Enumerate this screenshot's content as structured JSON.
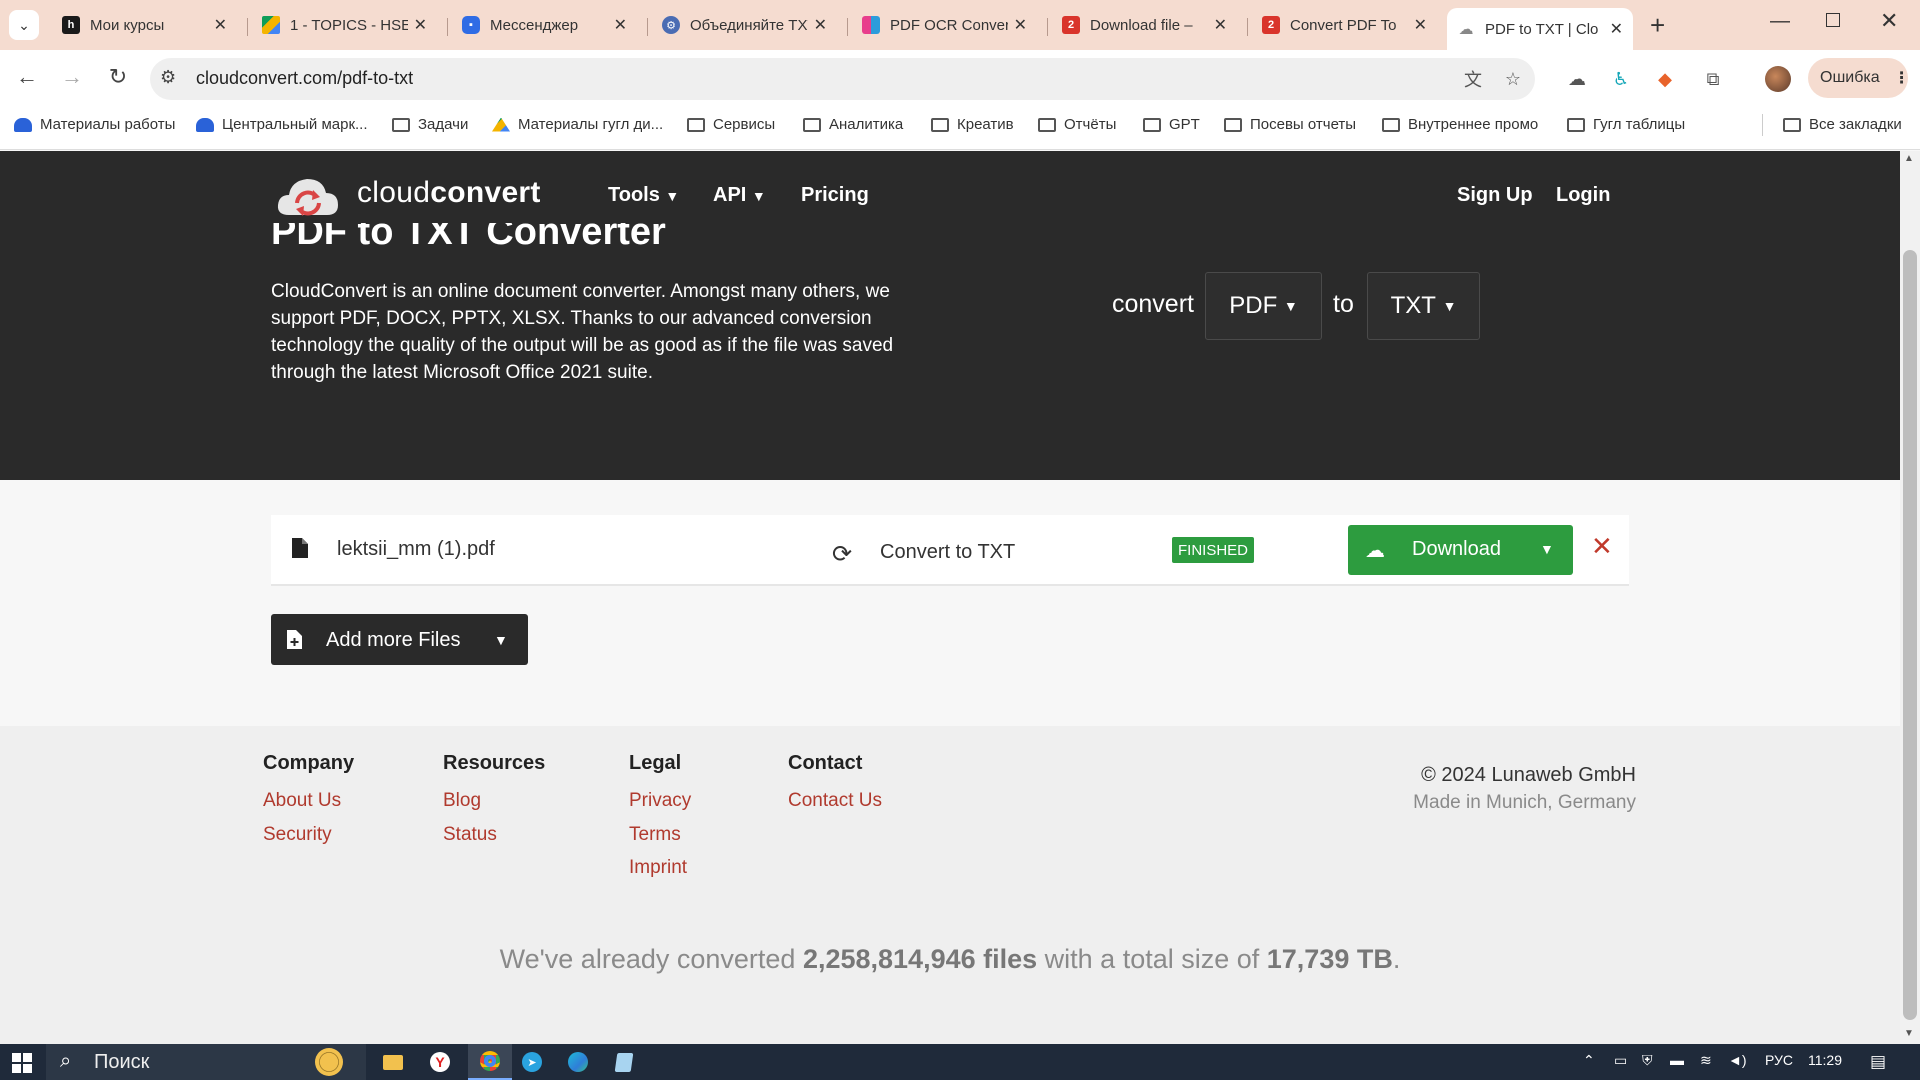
{
  "browser": {
    "tabs": [
      {
        "title": "Мои курсы",
        "favicon": "hse-icon",
        "color": "#1a1a1a"
      },
      {
        "title": "1 - TOPICS - HSE",
        "favicon": "drive-icon",
        "color": "#f4b400"
      },
      {
        "title": "Мессенджер",
        "favicon": "messenger-icon",
        "color": "#2f6ce5"
      },
      {
        "title": "Объединяйте TXT",
        "favicon": "ilove-icon",
        "color": "#4a6cb3"
      },
      {
        "title": "PDF OCR Conver",
        "favicon": "ocr-icon",
        "color": "#e83e8c"
      },
      {
        "title": "Download file –",
        "favicon": "pdf2go-icon",
        "color": "#d9342b"
      },
      {
        "title": "Convert PDF To",
        "favicon": "pdf2go-icon",
        "color": "#d9342b"
      },
      {
        "title": "PDF to TXT | Clo",
        "favicon": "cloudconvert-icon",
        "color": "#888888"
      }
    ],
    "url": "cloudconvert.com/pdf-to-txt",
    "profile_error": "Ошибка",
    "bookmarks": [
      {
        "label": "Материалы работы",
        "icon": "cloud-icon"
      },
      {
        "label": "Центральный марк...",
        "icon": "cloud-icon"
      },
      {
        "label": "Задачи",
        "icon": "folder-icon"
      },
      {
        "label": "Материалы гугл ди...",
        "icon": "drive-icon"
      },
      {
        "label": "Сервисы",
        "icon": "folder-icon"
      },
      {
        "label": "Аналитика",
        "icon": "folder-icon"
      },
      {
        "label": "Креатив",
        "icon": "folder-icon"
      },
      {
        "label": "Отчёты",
        "icon": "folder-icon"
      },
      {
        "label": "GPT",
        "icon": "folder-icon"
      },
      {
        "label": "Посевы отчеты",
        "icon": "folder-icon"
      },
      {
        "label": "Внутреннее промо",
        "icon": "folder-icon"
      },
      {
        "label": "Гугл таблицы",
        "icon": "folder-icon"
      }
    ],
    "all_bookmarks": "Все закладки"
  },
  "site": {
    "brand_light": "cloud",
    "brand_bold": "convert",
    "nav": {
      "tools": "Tools",
      "api": "API",
      "pricing": "Pricing",
      "signup": "Sign Up",
      "login": "Login"
    },
    "title": "PDF to TXT Converter",
    "description": "CloudConvert is an online document converter. Amongst many others, we support PDF, DOCX, PPTX, XLSX. Thanks to our advanced conversion technology the quality of the output will be as good as if the file was saved through the latest Microsoft Office 2021 suite.",
    "convert_word": "convert",
    "from_format": "PDF",
    "to_word": "to",
    "to_format": "TXT",
    "file": {
      "name": "lektsii_mm (1).pdf",
      "convert_label": "Convert to TXT",
      "status": "FINISHED",
      "download": "Download"
    },
    "add_more": "Add more Files",
    "colors": {
      "accent_green": "#2d9c3f",
      "hero_bg": "#2a2a2a",
      "link_red": "#b03a2e"
    }
  },
  "footer": {
    "company": {
      "title": "Company",
      "links": [
        "About Us",
        "Security"
      ]
    },
    "resources": {
      "title": "Resources",
      "links": [
        "Blog",
        "Status"
      ]
    },
    "legal": {
      "title": "Legal",
      "links": [
        "Privacy",
        "Terms",
        "Imprint"
      ]
    },
    "contact": {
      "title": "Contact",
      "links": [
        "Contact Us"
      ]
    },
    "copyright": "© 2024 Lunaweb GmbH",
    "made_in": "Made in Munich, Germany",
    "stats_pre": "We've already converted ",
    "stats_files": "2,258,814,946 files",
    "stats_mid": " with a total size of ",
    "stats_size": "17,739 TB",
    "stats_post": "."
  },
  "taskbar": {
    "search": "Поиск",
    "lang": "РУС",
    "time": "11:29"
  }
}
